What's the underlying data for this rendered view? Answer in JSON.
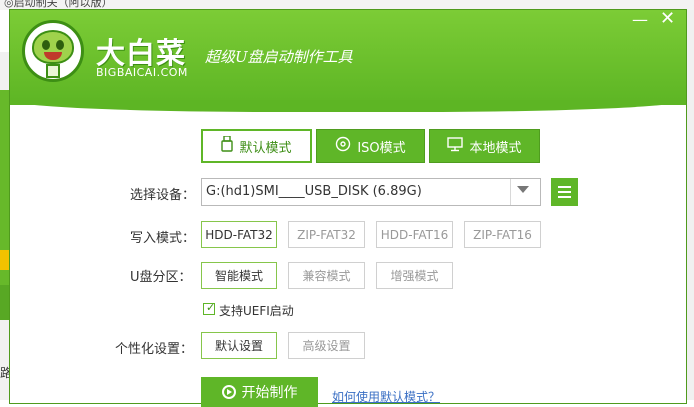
{
  "background": {
    "title_fragment": "◎启动制关（阿以版）",
    "bottom_fragment": "路"
  },
  "header": {
    "brand": "大白菜",
    "brand_url": "BIGBAICAI.COM",
    "slogan": "超级U盘启动制作工具"
  },
  "window_controls": {
    "minimize": "—",
    "close": "✕"
  },
  "tabs": [
    {
      "label": "默认模式",
      "icon": "usb-drive-icon",
      "active": true
    },
    {
      "label": "ISO模式",
      "icon": "disc-icon",
      "active": false
    },
    {
      "label": "本地模式",
      "icon": "monitor-icon",
      "active": false
    }
  ],
  "device": {
    "label": "选择设备：",
    "value": "G:(hd1)SMI____USB_DISK (6.89G)"
  },
  "write_mode": {
    "label": "写入模式：",
    "options": [
      "HDD-FAT32",
      "ZIP-FAT32",
      "HDD-FAT16",
      "ZIP-FAT16"
    ],
    "selected": "HDD-FAT32"
  },
  "partition": {
    "label": "U盘分区：",
    "options": [
      "智能模式",
      "兼容模式",
      "增强模式"
    ],
    "selected": "智能模式"
  },
  "uefi": {
    "label": "支持UEFI启动",
    "checked": true
  },
  "personalize": {
    "label": "个性化设置：",
    "options": [
      "默认设置",
      "高级设置"
    ],
    "selected": "默认设置"
  },
  "start_button": "开始制作",
  "help_link": "如何使用默认模式？",
  "colors": {
    "brand_green": "#5fb628",
    "dark_green": "#3f8f17",
    "link_blue": "#3a6fc4"
  }
}
